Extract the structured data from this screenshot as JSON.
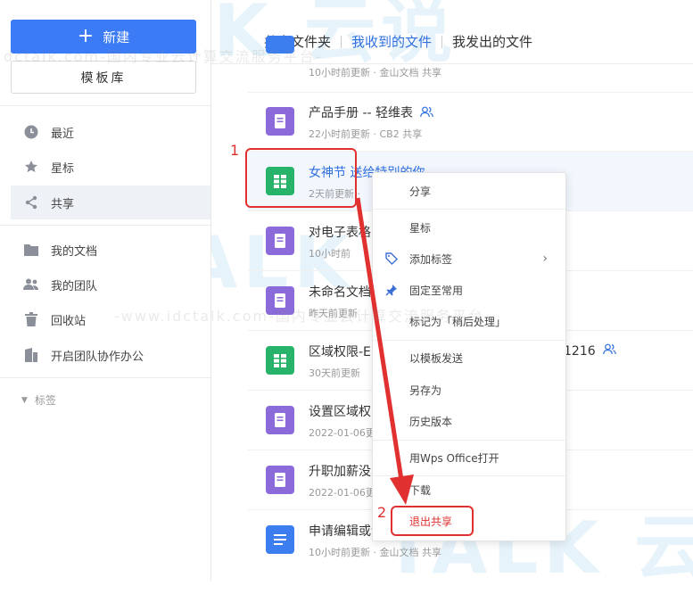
{
  "sidebar": {
    "new_label": "新建",
    "template_label": "模板库",
    "items": [
      {
        "label": "最近",
        "icon": "clock-icon"
      },
      {
        "label": "星标",
        "icon": "star-icon"
      },
      {
        "label": "共享",
        "icon": "share-icon"
      },
      {
        "label": "我的文档",
        "icon": "folder-icon"
      },
      {
        "label": "我的团队",
        "icon": "team-icon"
      },
      {
        "label": "回收站",
        "icon": "trash-icon"
      },
      {
        "label": "开启团队协作办公",
        "icon": "building-icon"
      }
    ],
    "tags_label": "标签"
  },
  "tabs": [
    "共享文件夹",
    "我收到的文件",
    "我发出的文件"
  ],
  "files": [
    {
      "title": "",
      "sub": "10小时前更新 · 金山文档 共享",
      "type": "blue"
    },
    {
      "title": "产品手册 -- 轻维表",
      "sub": "22小时前更新 · CB2 共享",
      "type": "purple"
    },
    {
      "title": "女神节 送给特别的你",
      "sub": "2天前更新 ·",
      "type": "green"
    },
    {
      "title": "对电子表格",
      "sub": "10小时前",
      "type": "purple"
    },
    {
      "title": "未命名文档",
      "sub": "昨天前更新",
      "type": "purple"
    },
    {
      "title": "区域权限-E",
      "sub": "30天前更新",
      "type": "green",
      "extra": "1216"
    },
    {
      "title": "设置区域权",
      "sub": "2022-01-06更",
      "type": "purple"
    },
    {
      "title": "升职加薪没",
      "sub": "2022-01-06更",
      "type": "purple"
    },
    {
      "title": "申请编辑或评论共享的文件",
      "sub": "10小时前更新 · 金山文档 共享",
      "type": "blue"
    }
  ],
  "menu": {
    "share": "分享",
    "star": "星标",
    "add_tag": "添加标签",
    "pin": "固定至常用",
    "later": "标记为「稍后处理」",
    "send_template": "以模板发送",
    "save_as": "另存为",
    "history": "历史版本",
    "open_wps": "用Wps Office打开",
    "download": "下载",
    "exit_share": "退出共享"
  },
  "annotations": {
    "step1": "1",
    "step2": "2"
  },
  "watermark": {
    "line": "-www.idctalk.com-国内专业云计算交流服务平台-",
    "line_top": "dctalk.com-国内专业云计算交流服务平台-",
    "big": "TALK 云说"
  },
  "colors": {
    "accent": "#3b7bf6",
    "annotation": "#e0302f"
  }
}
